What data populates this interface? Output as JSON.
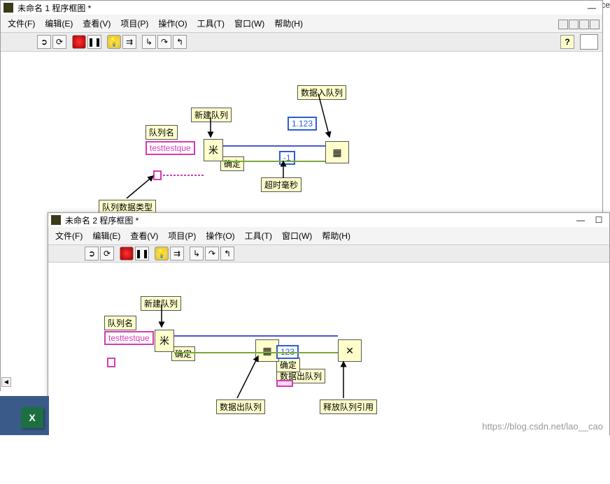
{
  "window1": {
    "title": "未命名 1 程序框图 *",
    "menus": [
      "文件(F)",
      "编辑(E)",
      "查看(V)",
      "项目(P)",
      "操作(O)",
      "工具(T)",
      "窗口(W)",
      "帮助(H)"
    ]
  },
  "window2": {
    "title": "未命名 2 程序框图 *",
    "menus": [
      "文件(F)",
      "编辑(E)",
      "查看(V)",
      "项目(P)",
      "操作(O)",
      "工具(T)",
      "窗口(W)",
      "帮助(H)"
    ]
  },
  "diagram1": {
    "queue_name_label": "队列名",
    "queue_name_value": "testtestque",
    "data_type_label": "队列数据类型",
    "new_queue_label": "新建队列",
    "enqueue_label": "数据入队列",
    "timeout_label": "超时毫秒",
    "confirm_label": "确定",
    "minus_one": "-1",
    "data_value": "1.123"
  },
  "diagram2": {
    "queue_name_label": "队列名",
    "queue_name_value": "testtestque",
    "new_queue_label": "新建队列",
    "dequeue_label": "数据出队列",
    "dequeue_label2": "数据出队列",
    "release_label": "释放队列引用",
    "confirm_label": "确定",
    "confirm_label2": "确定",
    "data_value": "123"
  },
  "watermark": "https://blog.csdn.net/lao__cao",
  "excel": "X",
  "help_glyph": "?"
}
